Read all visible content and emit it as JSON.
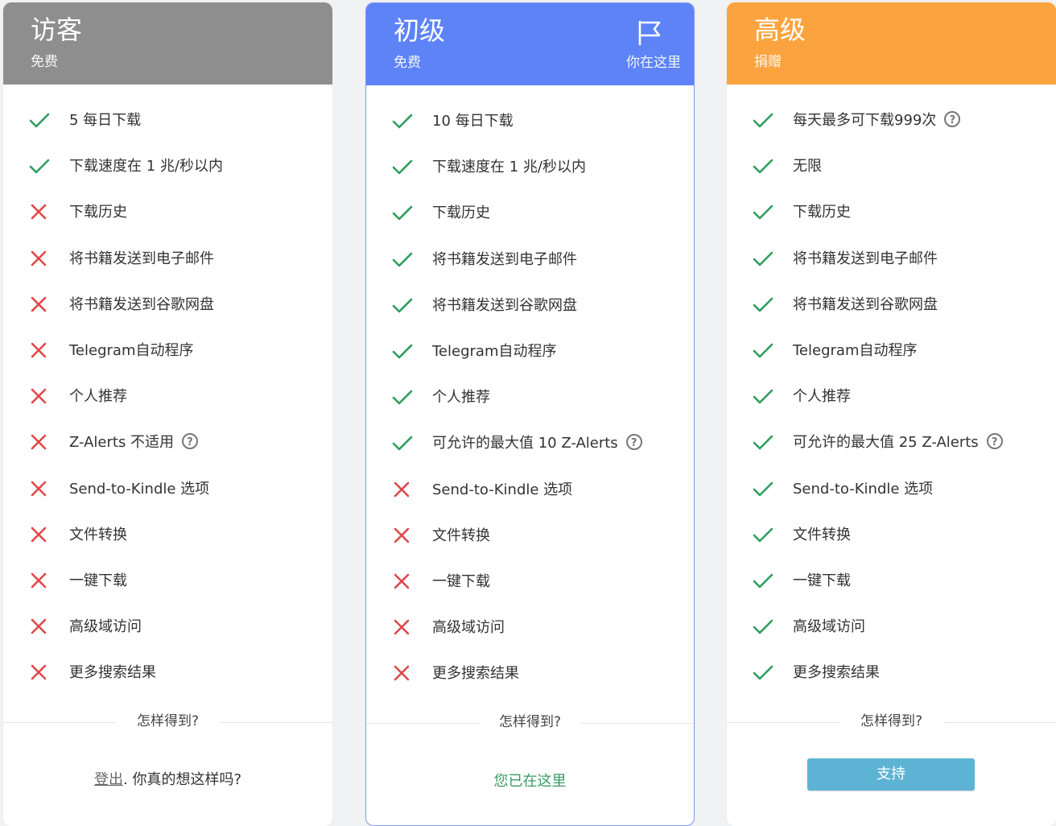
{
  "colors": {
    "guest_header": "#8e8e8e",
    "basic_header": "#5d83f7",
    "premium_header": "#fba43f",
    "check": "#2e9e5e",
    "cross": "#e0474a",
    "here_text": "#3a9a62",
    "support_button": "#5db3d3"
  },
  "plans": [
    {
      "title": "访客",
      "subtitle": "免费",
      "features": [
        {
          "label": "5 每日下载",
          "ok": true
        },
        {
          "label": "下载速度在 1 兆/秒以内",
          "ok": true
        },
        {
          "label": "下载历史",
          "ok": false
        },
        {
          "label": "将书籍发送到电子邮件",
          "ok": false
        },
        {
          "label": "将书籍发送到谷歌网盘",
          "ok": false
        },
        {
          "label": "Telegram自动程序",
          "ok": false
        },
        {
          "label": "个人推荐",
          "ok": false
        },
        {
          "label": "Z-Alerts 不适用",
          "ok": false,
          "help": "?"
        },
        {
          "label": "Send-to-Kindle 选项",
          "ok": false
        },
        {
          "label": "文件转换",
          "ok": false
        },
        {
          "label": "一键下载",
          "ok": false
        },
        {
          "label": "高级域访问",
          "ok": false
        },
        {
          "label": "更多搜索结果",
          "ok": false
        }
      ],
      "how": "怎样得到?",
      "logout_link": "登出",
      "logout_text": ". 你真的想这样吗?"
    },
    {
      "title": "初级",
      "subtitle": "免费",
      "here_label": "你在这里",
      "flag_icon": "flag-icon",
      "features": [
        {
          "label": "10 每日下载",
          "ok": true
        },
        {
          "label": "下载速度在 1 兆/秒以内",
          "ok": true
        },
        {
          "label": "下载历史",
          "ok": true
        },
        {
          "label": "将书籍发送到电子邮件",
          "ok": true
        },
        {
          "label": "将书籍发送到谷歌网盘",
          "ok": true
        },
        {
          "label": "Telegram自动程序",
          "ok": true
        },
        {
          "label": "个人推荐",
          "ok": true
        },
        {
          "label": "可允许的最大值 10 Z-Alerts",
          "ok": true,
          "help": "?"
        },
        {
          "label": "Send-to-Kindle 选项",
          "ok": false
        },
        {
          "label": "文件转换",
          "ok": false
        },
        {
          "label": "一键下载",
          "ok": false
        },
        {
          "label": "高级域访问",
          "ok": false
        },
        {
          "label": "更多搜索结果",
          "ok": false
        }
      ],
      "how": "怎样得到?",
      "status": "您已在这里"
    },
    {
      "title": "高级",
      "subtitle": "捐赠",
      "features": [
        {
          "label": "每天最多可下载999次",
          "ok": true,
          "help": "?"
        },
        {
          "label": "无限",
          "ok": true
        },
        {
          "label": "下载历史",
          "ok": true
        },
        {
          "label": "将书籍发送到电子邮件",
          "ok": true
        },
        {
          "label": "将书籍发送到谷歌网盘",
          "ok": true
        },
        {
          "label": "Telegram自动程序",
          "ok": true
        },
        {
          "label": "个人推荐",
          "ok": true
        },
        {
          "label": "可允许的最大值 25 Z-Alerts",
          "ok": true,
          "help": "?"
        },
        {
          "label": "Send-to-Kindle 选项",
          "ok": true
        },
        {
          "label": "文件转换",
          "ok": true
        },
        {
          "label": "一键下载",
          "ok": true
        },
        {
          "label": "高级域访问",
          "ok": true
        },
        {
          "label": "更多搜索结果",
          "ok": true
        }
      ],
      "how": "怎样得到?",
      "button": "支持"
    }
  ]
}
